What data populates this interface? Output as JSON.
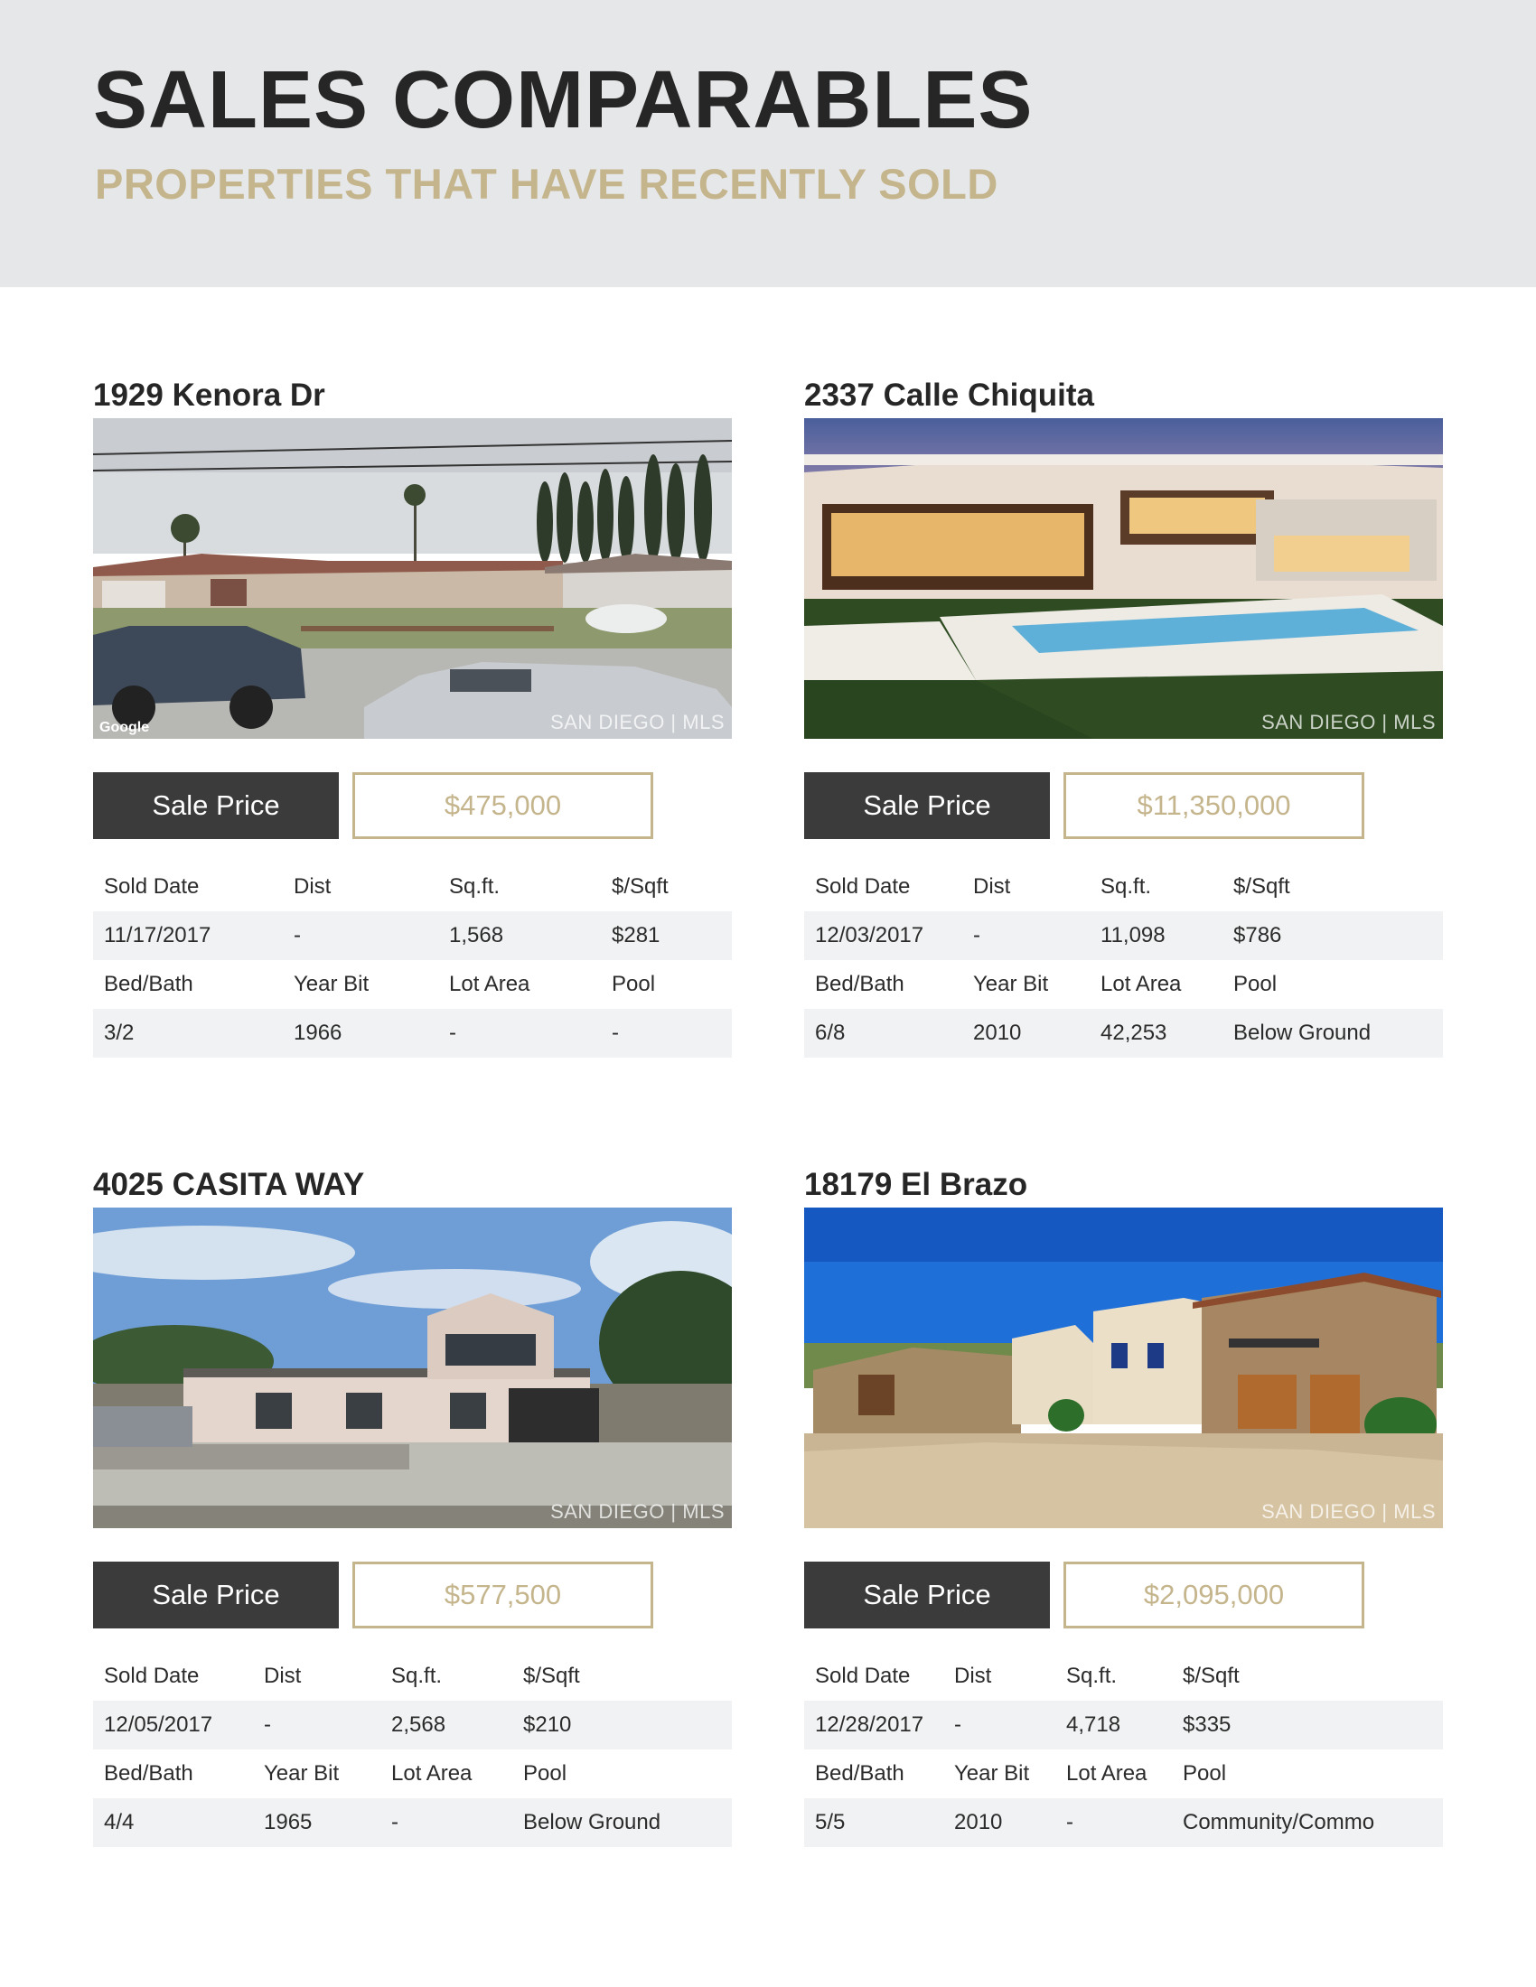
{
  "header": {
    "title": "SALES COMPARABLES",
    "subtitle": "PROPERTIES THAT HAVE RECENTLY SOLD"
  },
  "colors": {
    "accent": "#c5b58d",
    "dark_label": "#3b3b3b",
    "header_bg": "#e6e7e8",
    "row_shade": "#f1f2f3"
  },
  "watermark": "SAN DIEGO | MLS",
  "google_logo": "Google",
  "listings": [
    {
      "address": "1929 Kenora Dr",
      "price_label": "Sale Price",
      "price": "$475,000",
      "headers1": [
        "Sold Date",
        "Dist",
        "Sq.ft.",
        "$/Sqft"
      ],
      "values1": [
        "11/17/2017",
        "-",
        "1,568",
        "$281"
      ],
      "headers2": [
        "Bed/Bath",
        "Year Bit",
        "Lot Area",
        "Pool"
      ],
      "values2": [
        "3/2",
        "1966",
        "-",
        "-"
      ]
    },
    {
      "address": "2337 Calle Chiquita",
      "price_label": "Sale Price",
      "price": "$11,350,000",
      "headers1": [
        "Sold Date",
        "Dist",
        "Sq.ft.",
        "$/Sqft"
      ],
      "values1": [
        "12/03/2017",
        "-",
        "11,098",
        "$786"
      ],
      "headers2": [
        "Bed/Bath",
        "Year Bit",
        "Lot Area",
        "Pool"
      ],
      "values2": [
        "6/8",
        "2010",
        "42,253",
        "Below Ground"
      ]
    },
    {
      "address": "4025 CASITA WAY",
      "price_label": "Sale Price",
      "price": "$577,500",
      "headers1": [
        "Sold Date",
        "Dist",
        "Sq.ft.",
        "$/Sqft"
      ],
      "values1": [
        "12/05/2017",
        "-",
        "2,568",
        "$210"
      ],
      "headers2": [
        "Bed/Bath",
        "Year Bit",
        "Lot Area",
        "Pool"
      ],
      "values2": [
        "4/4",
        "1965",
        "-",
        "Below Ground"
      ]
    },
    {
      "address": "18179 El Brazo",
      "price_label": "Sale Price",
      "price": "$2,095,000",
      "headers1": [
        "Sold Date",
        "Dist",
        "Sq.ft.",
        "$/Sqft"
      ],
      "values1": [
        "12/28/2017",
        "-",
        "4,718",
        "$335"
      ],
      "headers2": [
        "Bed/Bath",
        "Year Bit",
        "Lot Area",
        "Pool"
      ],
      "values2": [
        "5/5",
        "2010",
        "-",
        "Community/Commo"
      ]
    }
  ]
}
